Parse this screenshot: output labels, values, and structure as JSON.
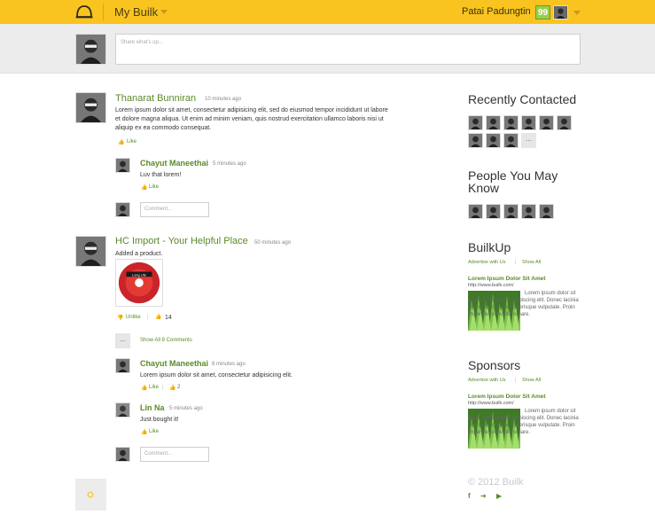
{
  "header": {
    "brand": "My Builk",
    "user_name": "Patai Padungtin",
    "user_badge": "99"
  },
  "share": {
    "placeholder": "Share what's up..."
  },
  "feed": {
    "post1": {
      "author": "Thanarat Bunniran",
      "time": "10 minutes ago",
      "text": "Lorem ipsum dolor sit amet, consectetur adipisicing elit, sed do eiusmod tempor incididunt ut labore et dolore magna aliqua. Ut enim ad minim veniam, quis nostrud exercitation ullamco laboris nisi ut aliquip ex ea commodo consequat.",
      "like_label": "Like",
      "comment1": {
        "author": "Chayut Maneethai",
        "time": "5 minutes ago",
        "text": "Luv that lorem!",
        "like_label": "Like"
      },
      "comment_placeholder": "Comment..."
    },
    "post2": {
      "author": "HC Import - Your Helpful Place",
      "time": "50 minutes ago",
      "text": "Added a product.",
      "unlike_label": "Unlike",
      "like_count": "14",
      "show_all_label": "Show All 8 Comments",
      "more_label": "...",
      "comment1": {
        "author": "Chayut Maneethai",
        "time": "8 minutes ago",
        "text": "Lorem ipsum dolor sit amet, consectetur adipisicing elit.",
        "like_label": "Like",
        "like_count": "2"
      },
      "comment2": {
        "author": "Lin Na",
        "time": "5 minutes ago",
        "text": "Just bought it!",
        "like_label": "Like"
      },
      "comment_placeholder": "Comment..."
    }
  },
  "sidebar": {
    "recent_title": "Recently Contacted",
    "recent_more": "...",
    "pymk_title": "People You May Know",
    "builkup": {
      "title": "BuilkUp",
      "advertise": "Advertise with Us",
      "show_all": "Show All",
      "ad_title": "Lorem Ipsum Dolor Sit Amet",
      "ad_url": "http://www.builk.com/",
      "ad_text": "Lorem ipsum dolor sit amet, consectetur adipiscing elit. Donec lacinia libero sit amet mi scelerisque vulputate. Proin imperdiet convallis ornare."
    },
    "sponsors": {
      "title": "Sponsors",
      "advertise": "Advertise with Us",
      "show_all": "Show All",
      "ad_title": "Lorem Ipsum Dolor Sit Amet",
      "ad_url": "http://www.builk.com/",
      "ad_text": "Lorem ipsum dolor sit amet, consectetur adipiscing elit. Donec lacinia libero sit amet mi scelerisque vulputate. Proin imperdiet convallis ornare."
    },
    "copyright": "© 2012 Builk"
  },
  "product_label": "Long Life",
  "colors": {
    "accent": "#f9c41f",
    "link": "#5a8a2a"
  },
  "icons": [
    "helmet-icon",
    "chevron-down-icon",
    "thumb-up-icon",
    "thumb-down-icon",
    "facebook-icon",
    "twitter-icon",
    "youtube-icon",
    "spinner-icon"
  ]
}
